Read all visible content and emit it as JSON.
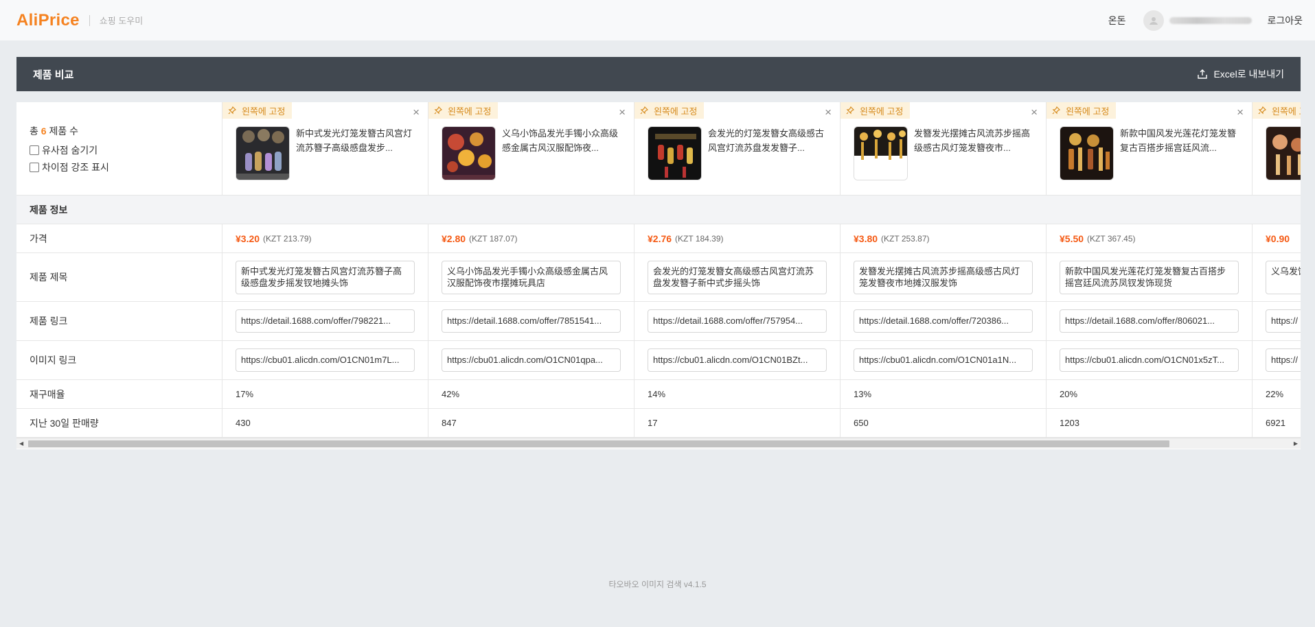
{
  "app": {
    "logo": "AliPrice",
    "tagline": "쇼핑 도우미"
  },
  "topbar": {
    "currency": "온돈",
    "logout": "로그아웃"
  },
  "panel": {
    "title": "제품 비교",
    "export_label": "Excel로 내보내기"
  },
  "summary": {
    "count_prefix": "총",
    "count": "6",
    "count_suffix": "제품 수",
    "hide_similar": "유사점 숨기기",
    "highlight_diff": "차이점 강조 표시"
  },
  "pin_label": "왼쪽에 고정",
  "rows": {
    "section": "제품 정보",
    "price": "가격",
    "title": "제품 제목",
    "product_link": "제품 링크",
    "image_link": "이미지 링크",
    "repurchase": "재구매율",
    "sales_30d": "지난 30일 판매량"
  },
  "products": [
    {
      "name": "新中式发光灯笼发簪古风宫灯流苏簪子高级感盘发步...",
      "price": "¥3.20",
      "price_local": "(KZT 213.79)",
      "title": "新中式发光灯笼发簪古风宫灯流苏簪子高级感盘发步摇发钗地摊头饰",
      "product_link": "https://detail.1688.com/offer/798221...",
      "image_link": "https://cbu01.alicdn.com/O1CN01m7L...",
      "repurchase": "17%",
      "sales": "430"
    },
    {
      "name": "义乌小饰品发光手镯小众高级感金属古风汉服配饰夜...",
      "price": "¥2.80",
      "price_local": "(KZT 187.07)",
      "title": "义乌小饰品发光手镯小众高级感金属古风汉服配饰夜市摆摊玩具店",
      "product_link": "https://detail.1688.com/offer/7851541...",
      "image_link": "https://cbu01.alicdn.com/O1CN01qpa...",
      "repurchase": "42%",
      "sales": "847"
    },
    {
      "name": "会发光的灯笼发簪女高级感古风宫灯流苏盘发发簪子...",
      "price": "¥2.76",
      "price_local": "(KZT 184.39)",
      "title": "会发光的灯笼发簪女高级感古风宫灯流苏盘发发簪子新中式步摇头饰",
      "product_link": "https://detail.1688.com/offer/757954...",
      "image_link": "https://cbu01.alicdn.com/O1CN01BZt...",
      "repurchase": "14%",
      "sales": "17"
    },
    {
      "name": "发簪发光摆摊古风流苏步摇高级感古风灯笼发簪夜市...",
      "price": "¥3.80",
      "price_local": "(KZT 253.87)",
      "title": "发簪发光摆摊古风流苏步摇高级感古风灯笼发簪夜市地摊汉服发饰",
      "product_link": "https://detail.1688.com/offer/720386...",
      "image_link": "https://cbu01.alicdn.com/O1CN01a1N...",
      "repurchase": "13%",
      "sales": "650"
    },
    {
      "name": "新款中国风发光莲花灯笼发簪复古百搭步摇宫廷风流...",
      "price": "¥5.50",
      "price_local": "(KZT 367.45)",
      "title": "新款中国风发光莲花灯笼发簪复古百搭步摇宫廷风流苏凤钗发饰现货",
      "product_link": "https://detail.1688.com/offer/806021...",
      "image_link": "https://cbu01.alicdn.com/O1CN01x5zT...",
      "repurchase": "20%",
      "sales": "1203"
    },
    {
      "name": "",
      "price": "¥0.90",
      "price_local": "",
      "title": "义乌发饰 廷仙气",
      "product_link": "https://",
      "image_link": "https://",
      "repurchase": "22%",
      "sales": "6921"
    }
  ],
  "colors": {
    "brand": "#f58220",
    "price": "#f55a14",
    "header_bg": "#414850",
    "pin_bg": "#fdf2dc"
  },
  "footer": "타오바오 이미지 검색 v4.1.5"
}
